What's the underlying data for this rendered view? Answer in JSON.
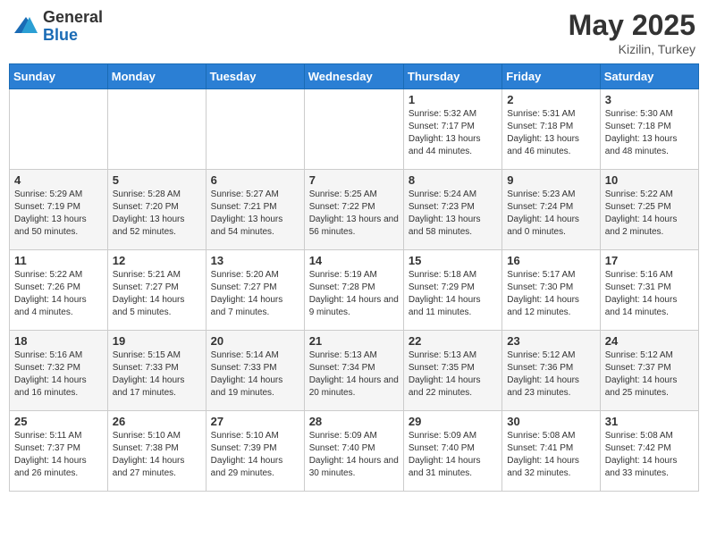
{
  "header": {
    "logo_general": "General",
    "logo_blue": "Blue",
    "month_year": "May 2025",
    "location": "Kizilin, Turkey"
  },
  "days_of_week": [
    "Sunday",
    "Monday",
    "Tuesday",
    "Wednesday",
    "Thursday",
    "Friday",
    "Saturday"
  ],
  "weeks": [
    [
      {
        "day": "",
        "sunrise": "",
        "sunset": "",
        "daylight": ""
      },
      {
        "day": "",
        "sunrise": "",
        "sunset": "",
        "daylight": ""
      },
      {
        "day": "",
        "sunrise": "",
        "sunset": "",
        "daylight": ""
      },
      {
        "day": "",
        "sunrise": "",
        "sunset": "",
        "daylight": ""
      },
      {
        "day": "1",
        "sunrise": "Sunrise: 5:32 AM",
        "sunset": "Sunset: 7:17 PM",
        "daylight": "Daylight: 13 hours and 44 minutes."
      },
      {
        "day": "2",
        "sunrise": "Sunrise: 5:31 AM",
        "sunset": "Sunset: 7:18 PM",
        "daylight": "Daylight: 13 hours and 46 minutes."
      },
      {
        "day": "3",
        "sunrise": "Sunrise: 5:30 AM",
        "sunset": "Sunset: 7:18 PM",
        "daylight": "Daylight: 13 hours and 48 minutes."
      }
    ],
    [
      {
        "day": "4",
        "sunrise": "Sunrise: 5:29 AM",
        "sunset": "Sunset: 7:19 PM",
        "daylight": "Daylight: 13 hours and 50 minutes."
      },
      {
        "day": "5",
        "sunrise": "Sunrise: 5:28 AM",
        "sunset": "Sunset: 7:20 PM",
        "daylight": "Daylight: 13 hours and 52 minutes."
      },
      {
        "day": "6",
        "sunrise": "Sunrise: 5:27 AM",
        "sunset": "Sunset: 7:21 PM",
        "daylight": "Daylight: 13 hours and 54 minutes."
      },
      {
        "day": "7",
        "sunrise": "Sunrise: 5:25 AM",
        "sunset": "Sunset: 7:22 PM",
        "daylight": "Daylight: 13 hours and 56 minutes."
      },
      {
        "day": "8",
        "sunrise": "Sunrise: 5:24 AM",
        "sunset": "Sunset: 7:23 PM",
        "daylight": "Daylight: 13 hours and 58 minutes."
      },
      {
        "day": "9",
        "sunrise": "Sunrise: 5:23 AM",
        "sunset": "Sunset: 7:24 PM",
        "daylight": "Daylight: 14 hours and 0 minutes."
      },
      {
        "day": "10",
        "sunrise": "Sunrise: 5:22 AM",
        "sunset": "Sunset: 7:25 PM",
        "daylight": "Daylight: 14 hours and 2 minutes."
      }
    ],
    [
      {
        "day": "11",
        "sunrise": "Sunrise: 5:22 AM",
        "sunset": "Sunset: 7:26 PM",
        "daylight": "Daylight: 14 hours and 4 minutes."
      },
      {
        "day": "12",
        "sunrise": "Sunrise: 5:21 AM",
        "sunset": "Sunset: 7:27 PM",
        "daylight": "Daylight: 14 hours and 5 minutes."
      },
      {
        "day": "13",
        "sunrise": "Sunrise: 5:20 AM",
        "sunset": "Sunset: 7:27 PM",
        "daylight": "Daylight: 14 hours and 7 minutes."
      },
      {
        "day": "14",
        "sunrise": "Sunrise: 5:19 AM",
        "sunset": "Sunset: 7:28 PM",
        "daylight": "Daylight: 14 hours and 9 minutes."
      },
      {
        "day": "15",
        "sunrise": "Sunrise: 5:18 AM",
        "sunset": "Sunset: 7:29 PM",
        "daylight": "Daylight: 14 hours and 11 minutes."
      },
      {
        "day": "16",
        "sunrise": "Sunrise: 5:17 AM",
        "sunset": "Sunset: 7:30 PM",
        "daylight": "Daylight: 14 hours and 12 minutes."
      },
      {
        "day": "17",
        "sunrise": "Sunrise: 5:16 AM",
        "sunset": "Sunset: 7:31 PM",
        "daylight": "Daylight: 14 hours and 14 minutes."
      }
    ],
    [
      {
        "day": "18",
        "sunrise": "Sunrise: 5:16 AM",
        "sunset": "Sunset: 7:32 PM",
        "daylight": "Daylight: 14 hours and 16 minutes."
      },
      {
        "day": "19",
        "sunrise": "Sunrise: 5:15 AM",
        "sunset": "Sunset: 7:33 PM",
        "daylight": "Daylight: 14 hours and 17 minutes."
      },
      {
        "day": "20",
        "sunrise": "Sunrise: 5:14 AM",
        "sunset": "Sunset: 7:33 PM",
        "daylight": "Daylight: 14 hours and 19 minutes."
      },
      {
        "day": "21",
        "sunrise": "Sunrise: 5:13 AM",
        "sunset": "Sunset: 7:34 PM",
        "daylight": "Daylight: 14 hours and 20 minutes."
      },
      {
        "day": "22",
        "sunrise": "Sunrise: 5:13 AM",
        "sunset": "Sunset: 7:35 PM",
        "daylight": "Daylight: 14 hours and 22 minutes."
      },
      {
        "day": "23",
        "sunrise": "Sunrise: 5:12 AM",
        "sunset": "Sunset: 7:36 PM",
        "daylight": "Daylight: 14 hours and 23 minutes."
      },
      {
        "day": "24",
        "sunrise": "Sunrise: 5:12 AM",
        "sunset": "Sunset: 7:37 PM",
        "daylight": "Daylight: 14 hours and 25 minutes."
      }
    ],
    [
      {
        "day": "25",
        "sunrise": "Sunrise: 5:11 AM",
        "sunset": "Sunset: 7:37 PM",
        "daylight": "Daylight: 14 hours and 26 minutes."
      },
      {
        "day": "26",
        "sunrise": "Sunrise: 5:10 AM",
        "sunset": "Sunset: 7:38 PM",
        "daylight": "Daylight: 14 hours and 27 minutes."
      },
      {
        "day": "27",
        "sunrise": "Sunrise: 5:10 AM",
        "sunset": "Sunset: 7:39 PM",
        "daylight": "Daylight: 14 hours and 29 minutes."
      },
      {
        "day": "28",
        "sunrise": "Sunrise: 5:09 AM",
        "sunset": "Sunset: 7:40 PM",
        "daylight": "Daylight: 14 hours and 30 minutes."
      },
      {
        "day": "29",
        "sunrise": "Sunrise: 5:09 AM",
        "sunset": "Sunset: 7:40 PM",
        "daylight": "Daylight: 14 hours and 31 minutes."
      },
      {
        "day": "30",
        "sunrise": "Sunrise: 5:08 AM",
        "sunset": "Sunset: 7:41 PM",
        "daylight": "Daylight: 14 hours and 32 minutes."
      },
      {
        "day": "31",
        "sunrise": "Sunrise: 5:08 AM",
        "sunset": "Sunset: 7:42 PM",
        "daylight": "Daylight: 14 hours and 33 minutes."
      }
    ]
  ]
}
